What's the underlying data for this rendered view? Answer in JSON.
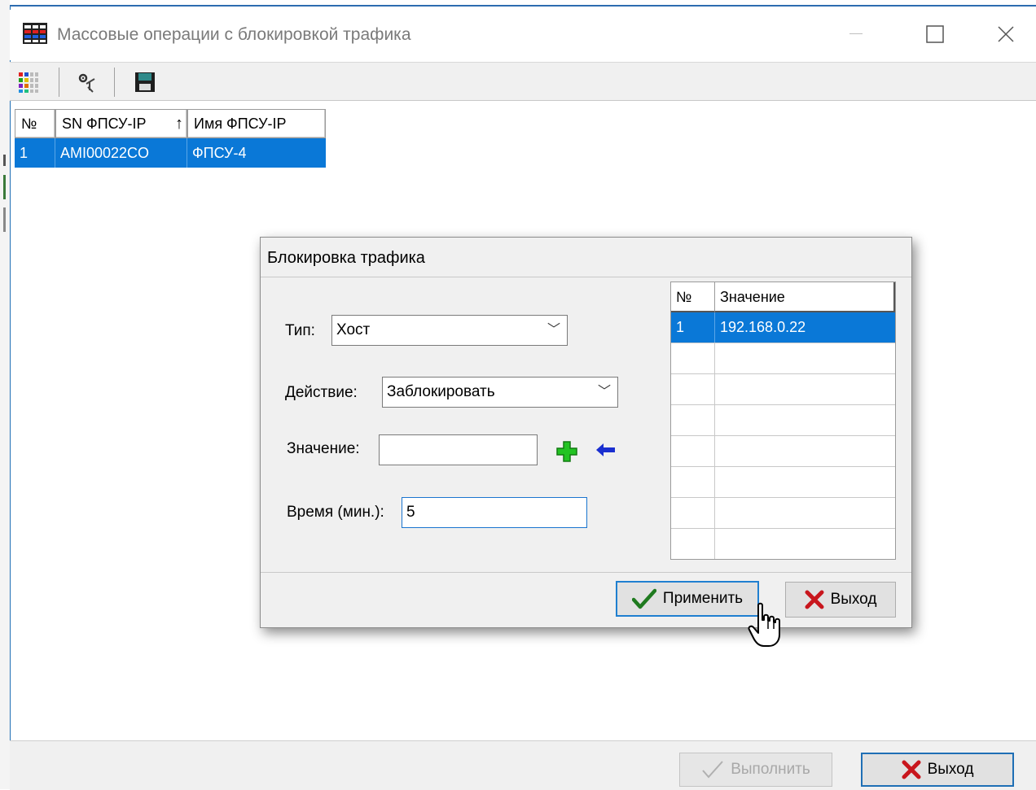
{
  "window": {
    "title": "Массовые операции с блокировкой трафика",
    "controls": [
      "minimize",
      "maximize",
      "close"
    ]
  },
  "toolbar": {
    "buttons": [
      {
        "icon": "columns-grid-icon"
      },
      {
        "icon": "settings-tools-icon"
      },
      {
        "icon": "save-floppy-icon"
      }
    ]
  },
  "grid": {
    "columns": [
      "№",
      "SN ФПСУ-IP",
      "Имя ФПСУ-IP"
    ],
    "sort_indicator": "↑",
    "rows": [
      {
        "num": "1",
        "sn": "AMI00022CO",
        "name": "ФПСУ-4"
      }
    ]
  },
  "dialog": {
    "title": "Блокировка трафика",
    "type_label": "Тип:",
    "type_value": "Хост",
    "action_label": "Действие:",
    "action_value": "Заблокировать",
    "value_label": "Значение:",
    "value_input": "",
    "time_label": "Время (мин.):",
    "time_value": "5",
    "table": {
      "columns": [
        "№",
        "Значение"
      ],
      "rows": [
        {
          "num": "1",
          "value": "192.168.0.22"
        }
      ]
    },
    "apply_label": "Применить",
    "exit_label": "Выход"
  },
  "footer": {
    "execute_label": "Выполнить",
    "exit_label": "Выход"
  },
  "colors": {
    "selection": "#0a78d7",
    "accent_border": "#1f6fb5",
    "add_icon": "#22c322",
    "arrow_icon": "#1a2fd0",
    "close_x": "#c8161d",
    "check": "#1f7a1f"
  }
}
